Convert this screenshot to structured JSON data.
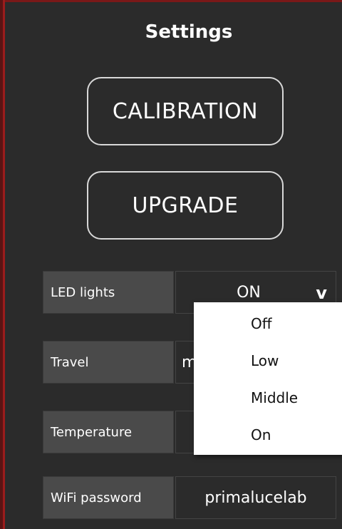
{
  "title": "Settings",
  "buttons": {
    "calibration": "CALIBRATION",
    "upgrade": "UPGRADE"
  },
  "rows": {
    "led": {
      "label": "LED lights",
      "value": "ON"
    },
    "travel": {
      "label": "Travel",
      "value": "m"
    },
    "temperature": {
      "label": "Temperature",
      "value": ""
    },
    "wifi": {
      "label": "WiFi password",
      "value": "primalucelab"
    }
  },
  "led_dropdown": {
    "open": true,
    "options": [
      "Off",
      "Low",
      "Middle",
      "On"
    ]
  },
  "icons": {
    "chevron": "v"
  },
  "colors": {
    "background": "#2b2b2b",
    "label_background": "#4a4a4a",
    "border_accent": "#9b1c1c",
    "dropdown_background": "#ffffff"
  }
}
